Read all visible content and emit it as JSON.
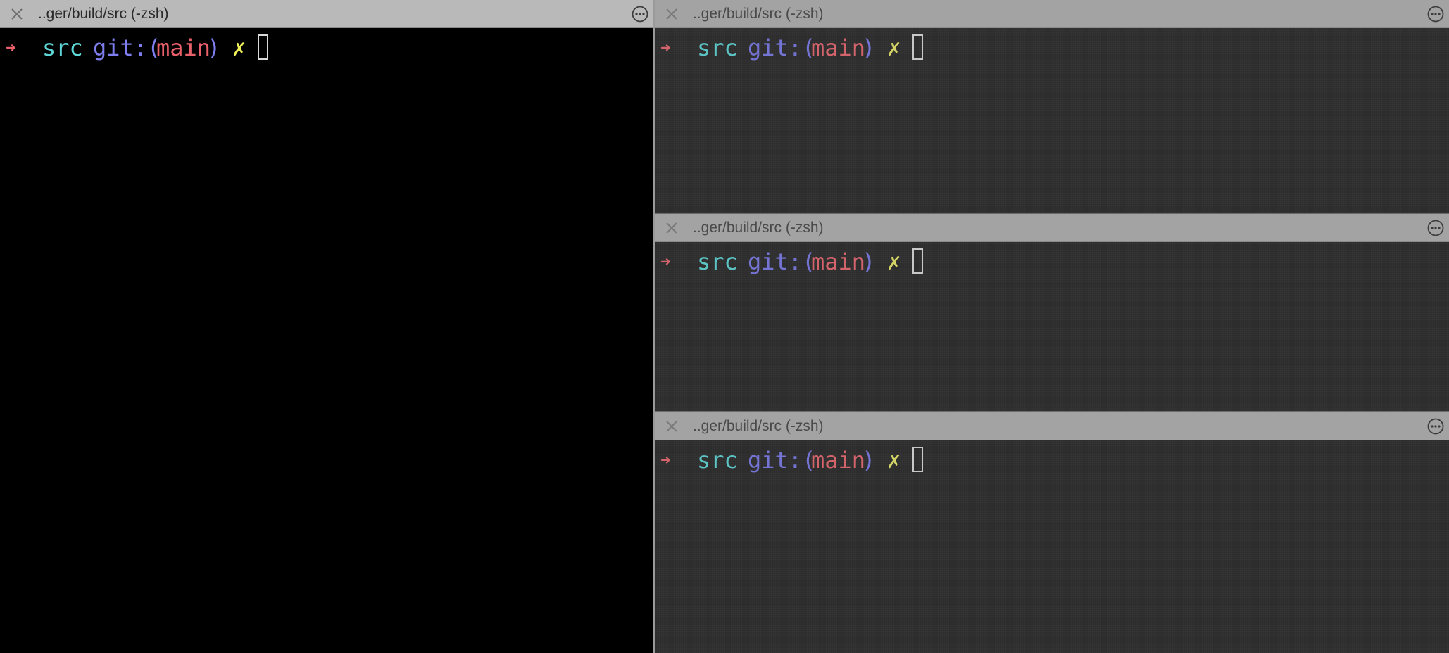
{
  "colors": {
    "arrow": "#e8606a",
    "dir": "#5ed6d6",
    "git": "#7e7ef0",
    "branch": "#e8606a",
    "dirty": "#e8e86a",
    "cursor": "#d8d8d8"
  },
  "icons": {
    "close": "close-icon",
    "more": "ellipsis-circle-icon"
  },
  "panes": [
    {
      "title": "..ger/build/src (-zsh)",
      "prompt": {
        "arrow": "➜",
        "dir": "src",
        "git_prefix": "git:(",
        "branch": "main",
        "git_suffix": ")",
        "dirty": "✗"
      }
    },
    {
      "title": "..ger/build/src (-zsh)",
      "prompt": {
        "arrow": "➜",
        "dir": "src",
        "git_prefix": "git:(",
        "branch": "main",
        "git_suffix": ")",
        "dirty": "✗"
      }
    },
    {
      "title": "..ger/build/src (-zsh)",
      "prompt": {
        "arrow": "➜",
        "dir": "src",
        "git_prefix": "git:(",
        "branch": "main",
        "git_suffix": ")",
        "dirty": "✗"
      }
    },
    {
      "title": "..ger/build/src (-zsh)",
      "prompt": {
        "arrow": "➜",
        "dir": "src",
        "git_prefix": "git:(",
        "branch": "main",
        "git_suffix": ")",
        "dirty": "✗"
      }
    }
  ]
}
